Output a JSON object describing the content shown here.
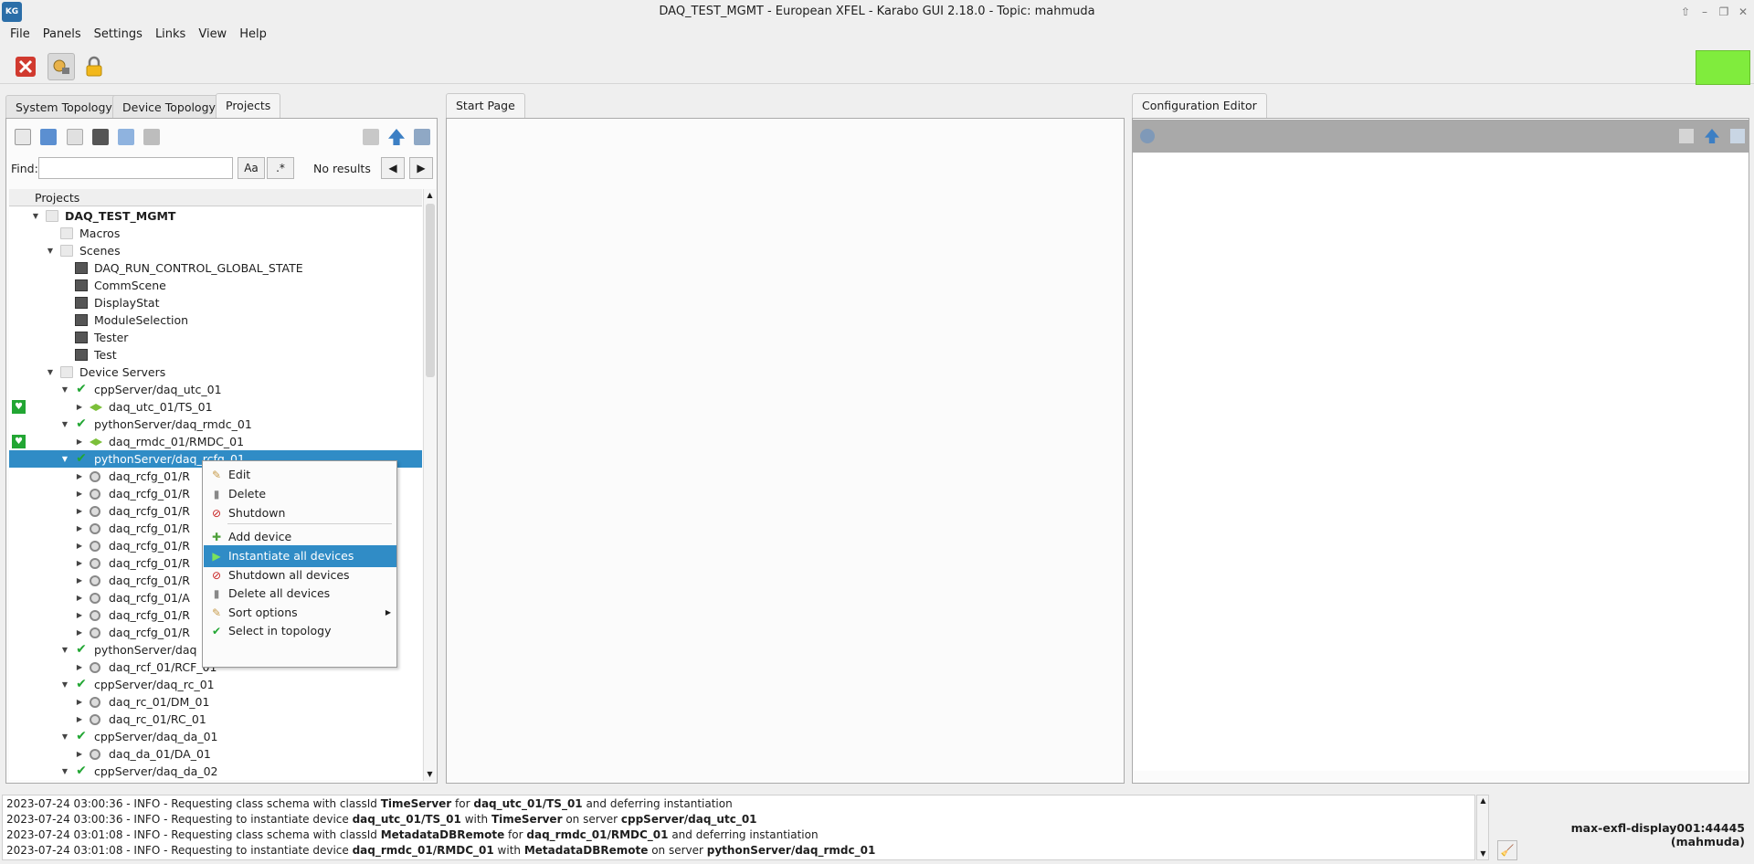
{
  "window": {
    "title": "DAQ_TEST_MGMT - European XFEL - Karabo GUI 2.18.0 - Topic: mahmuda",
    "icon_text": "KG"
  },
  "menubar": [
    "File",
    "Panels",
    "Settings",
    "Links",
    "View",
    "Help"
  ],
  "toolbar": {
    "icons": [
      "disconnect-icon",
      "access-level-icon",
      "lock-icon"
    ]
  },
  "status_indicator_color": "#80ec3d",
  "left_tabs": [
    "System Topology",
    "Device Topology",
    "Projects"
  ],
  "center_tab": "Start Page",
  "right_tab": "Configuration Editor",
  "find": {
    "label": "Find:",
    "value": "",
    "case_btn": "Aa",
    "regex_btn": ".*",
    "results": "No results"
  },
  "tree": {
    "header": "Projects",
    "rows": [
      {
        "label": "DAQ_TEST_MGMT",
        "depth": 1,
        "icon": "folder",
        "exp": "open",
        "bold": true
      },
      {
        "label": "Macros",
        "depth": 2,
        "icon": "folder",
        "exp": ""
      },
      {
        "label": "Scenes",
        "depth": 2,
        "icon": "folder",
        "exp": "open"
      },
      {
        "label": "DAQ_RUN_CONTROL_GLOBAL_STATE",
        "depth": 3,
        "icon": "scene",
        "exp": ""
      },
      {
        "label": "CommScene",
        "depth": 3,
        "icon": "scene",
        "exp": ""
      },
      {
        "label": "DisplayStat",
        "depth": 3,
        "icon": "scene",
        "exp": ""
      },
      {
        "label": "ModuleSelection",
        "depth": 3,
        "icon": "scene",
        "exp": ""
      },
      {
        "label": "Tester",
        "depth": 3,
        "icon": "scene",
        "exp": ""
      },
      {
        "label": "Test",
        "depth": 3,
        "icon": "scene",
        "exp": ""
      },
      {
        "label": "Device Servers",
        "depth": 2,
        "icon": "folder",
        "exp": "open"
      },
      {
        "label": "cppServer/daq_utc_01",
        "depth": 3,
        "icon": "check",
        "exp": "open"
      },
      {
        "label": "daq_utc_01/TS_01",
        "depth": 4,
        "icon": "diamond",
        "exp": "closed",
        "heart": true
      },
      {
        "label": "pythonServer/daq_rmdc_01",
        "depth": 3,
        "icon": "check",
        "exp": "open"
      },
      {
        "label": "daq_rmdc_01/RMDC_01",
        "depth": 4,
        "icon": "diamond",
        "exp": "closed",
        "heart": true
      },
      {
        "label": "pythonServer/daq_rcfg_01",
        "depth": 3,
        "icon": "check",
        "exp": "open",
        "selected": true
      },
      {
        "label": "daq_rcfg_01/R",
        "depth": 4,
        "icon": "gear",
        "exp": "closed"
      },
      {
        "label": "daq_rcfg_01/R",
        "depth": 4,
        "icon": "gear",
        "exp": "closed"
      },
      {
        "label": "daq_rcfg_01/R",
        "depth": 4,
        "icon": "gear",
        "exp": "closed"
      },
      {
        "label": "daq_rcfg_01/R",
        "depth": 4,
        "icon": "gear",
        "exp": "closed"
      },
      {
        "label": "daq_rcfg_01/R",
        "depth": 4,
        "icon": "gear",
        "exp": "closed"
      },
      {
        "label": "daq_rcfg_01/R",
        "depth": 4,
        "icon": "gear",
        "exp": "closed"
      },
      {
        "label": "daq_rcfg_01/R",
        "depth": 4,
        "icon": "gear",
        "exp": "closed"
      },
      {
        "label": "daq_rcfg_01/A",
        "depth": 4,
        "icon": "gear",
        "exp": "closed"
      },
      {
        "label": "daq_rcfg_01/R",
        "depth": 4,
        "icon": "gear",
        "exp": "closed"
      },
      {
        "label": "daq_rcfg_01/R",
        "depth": 4,
        "icon": "gear",
        "exp": "closed"
      },
      {
        "label": "pythonServer/daq",
        "depth": 3,
        "icon": "check",
        "exp": "open"
      },
      {
        "label": "daq_rcf_01/RCF_01",
        "depth": 4,
        "icon": "gear",
        "exp": "closed"
      },
      {
        "label": "cppServer/daq_rc_01",
        "depth": 3,
        "icon": "check",
        "exp": "open"
      },
      {
        "label": "daq_rc_01/DM_01",
        "depth": 4,
        "icon": "gear",
        "exp": "closed"
      },
      {
        "label": "daq_rc_01/RC_01",
        "depth": 4,
        "icon": "gear",
        "exp": "closed"
      },
      {
        "label": "cppServer/daq_da_01",
        "depth": 3,
        "icon": "check",
        "exp": "open"
      },
      {
        "label": "daq_da_01/DA_01",
        "depth": 4,
        "icon": "gear",
        "exp": "closed"
      },
      {
        "label": "cppServer/daq_da_02",
        "depth": 3,
        "icon": "check",
        "exp": "open"
      }
    ]
  },
  "context_menu": {
    "items": [
      {
        "label": "Edit",
        "icon": "edit-icon"
      },
      {
        "label": "Delete",
        "icon": "trash-icon"
      },
      {
        "label": "Shutdown",
        "icon": "shutdown-icon"
      },
      {
        "label": "Add device",
        "icon": "plus-icon"
      },
      {
        "label": "Instantiate all devices",
        "icon": "play-icon"
      },
      {
        "label": "Shutdown all devices",
        "icon": "shutdown-icon"
      },
      {
        "label": "Delete all devices",
        "icon": "trash-icon"
      },
      {
        "label": "Sort options",
        "icon": "edit-icon"
      },
      {
        "label": "Select in topology",
        "icon": "check-icon"
      }
    ]
  },
  "log": [
    {
      "pre": "2023-07-24 03:00:36 - INFO - Requesting class schema with classId ",
      "b1": "TimeServer",
      "mid": " for ",
      "b2": "daq_utc_01/TS_01",
      "post": " and deferring instantiation",
      "b3": ""
    },
    {
      "pre": "2023-07-24 03:00:36 - INFO - Requesting to instantiate device ",
      "b1": "daq_utc_01/TS_01",
      "mid": " with ",
      "b2": "TimeServer",
      "post": " on server ",
      "b3": "cppServer/daq_utc_01"
    },
    {
      "pre": "2023-07-24 03:01:08 - INFO - Requesting class schema with classId ",
      "b1": "MetadataDBRemote",
      "mid": " for ",
      "b2": "daq_rmdc_01/RMDC_01",
      "post": " and deferring instantiation",
      "b3": ""
    },
    {
      "pre": "2023-07-24 03:01:08 - INFO - Requesting to instantiate device ",
      "b1": "daq_rmdc_01/RMDC_01",
      "mid": " with ",
      "b2": "MetadataDBRemote",
      "post": " on server ",
      "b3": "pythonServer/daq_rmdc_01"
    }
  ],
  "server_label": "max-exfl-display001:44445 (mahmuda)"
}
